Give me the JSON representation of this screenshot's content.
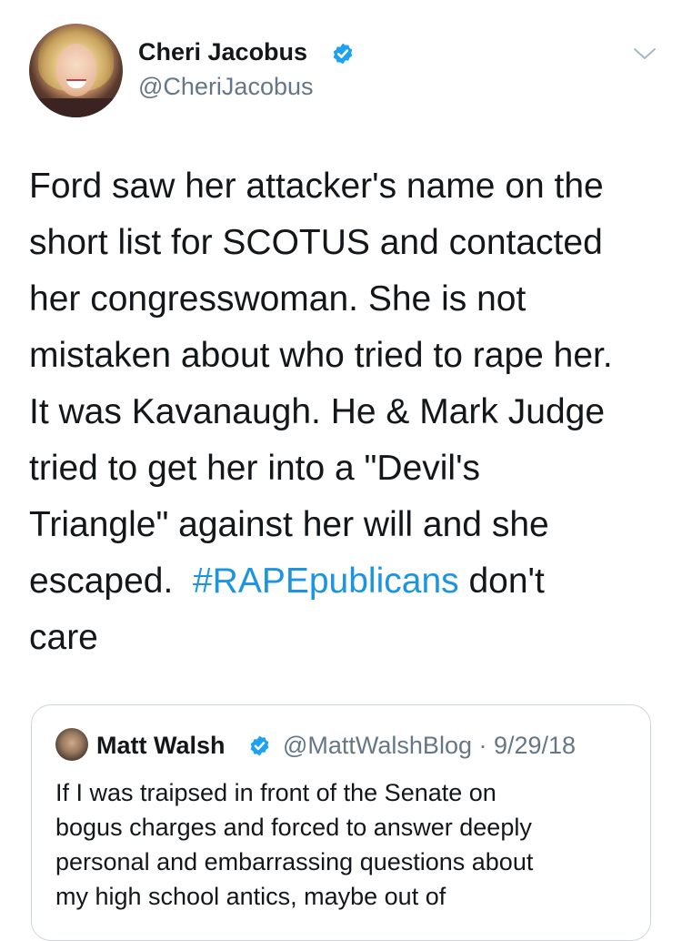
{
  "tweet": {
    "author_name": "Cheri Jacobus",
    "author_handle": "@CheriJacobus",
    "body_lines": [
      "Ford saw her attacker's name on the",
      "short list for SCOTUS and contacted",
      "her congresswoman.  She is not",
      "mistaken about who tried to rape her.",
      "It was Kavanaugh.  He & Mark Judge",
      "tried to get her into a \"Devil's",
      "Triangle\" against her will and she",
      "escaped.",
      "care"
    ],
    "hashtag": "#RAPEpublicans",
    "after_hashtag": " don't",
    "hashtag_color": "#1b95e0",
    "verified_color": "#1da1f2"
  },
  "quoted_tweet": {
    "author_name": "Matt Walsh",
    "meta": "@MattWalshBlog · 9/29/18",
    "body_lines": [
      "If I was traipsed in front of the Senate on",
      "bogus charges and forced to answer deeply",
      "personal and embarrassing questions about",
      "my high school antics, maybe out of"
    ]
  },
  "icons": {
    "verified": "verified-badge-icon",
    "menu": "chevron-down-icon"
  }
}
